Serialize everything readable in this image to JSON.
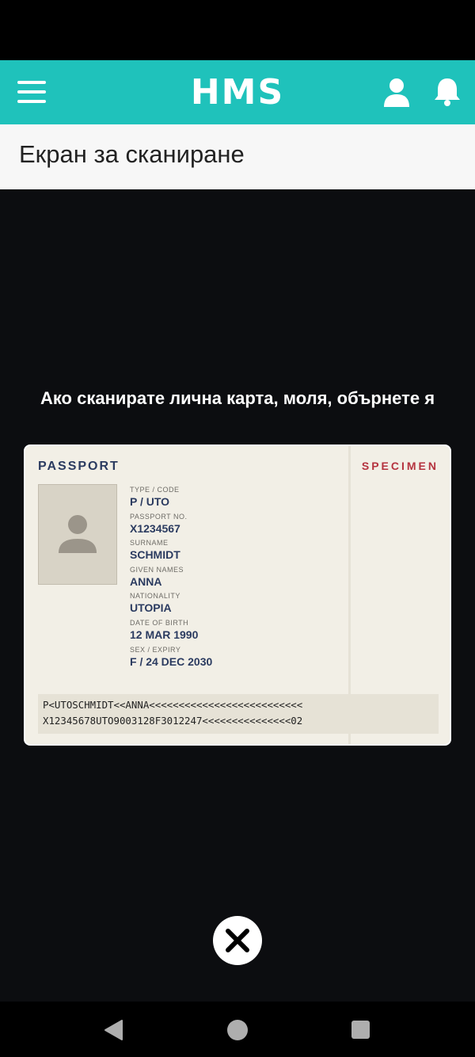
{
  "app_bar": {
    "logo": "HMS"
  },
  "page": {
    "title": "Екран за сканиране"
  },
  "scan": {
    "instruction": "Ако сканирате лична карта, моля, обърнете я",
    "passport": {
      "title": "PASSPORT",
      "specimen": "SPECIMEN",
      "fields": [
        {
          "label": "TYPE / CODE",
          "value": "P / UTO"
        },
        {
          "label": "PASSPORT NO.",
          "value": "X1234567"
        },
        {
          "label": "SURNAME",
          "value": "SCHMIDT"
        },
        {
          "label": "GIVEN NAMES",
          "value": "ANNA"
        },
        {
          "label": "NATIONALITY",
          "value": "UTOPIA"
        },
        {
          "label": "DATE OF BIRTH",
          "value": "12 MAR 1990"
        },
        {
          "label": "SEX / EXPIRY",
          "value": "F / 24 DEC 2030"
        }
      ],
      "mrz_line1": "P<UTOSCHMIDT<<ANNA<<<<<<<<<<<<<<<<<<<<<<<<<<",
      "mrz_line2": "X12345678UTO9003128F3012247<<<<<<<<<<<<<<<02"
    }
  },
  "icons": {
    "menu": "menu-icon",
    "user": "user-icon",
    "bell": "bell-icon",
    "close": "close-icon",
    "back": "back-icon",
    "home": "home-icon",
    "recents": "recents-icon"
  },
  "colors": {
    "app_bar": "#1fc2bb",
    "title_bar": "#f7f7f7",
    "scan_background": "#0c0d10",
    "passport_navy": "#2b3b60",
    "specimen_red": "#b5333f"
  }
}
